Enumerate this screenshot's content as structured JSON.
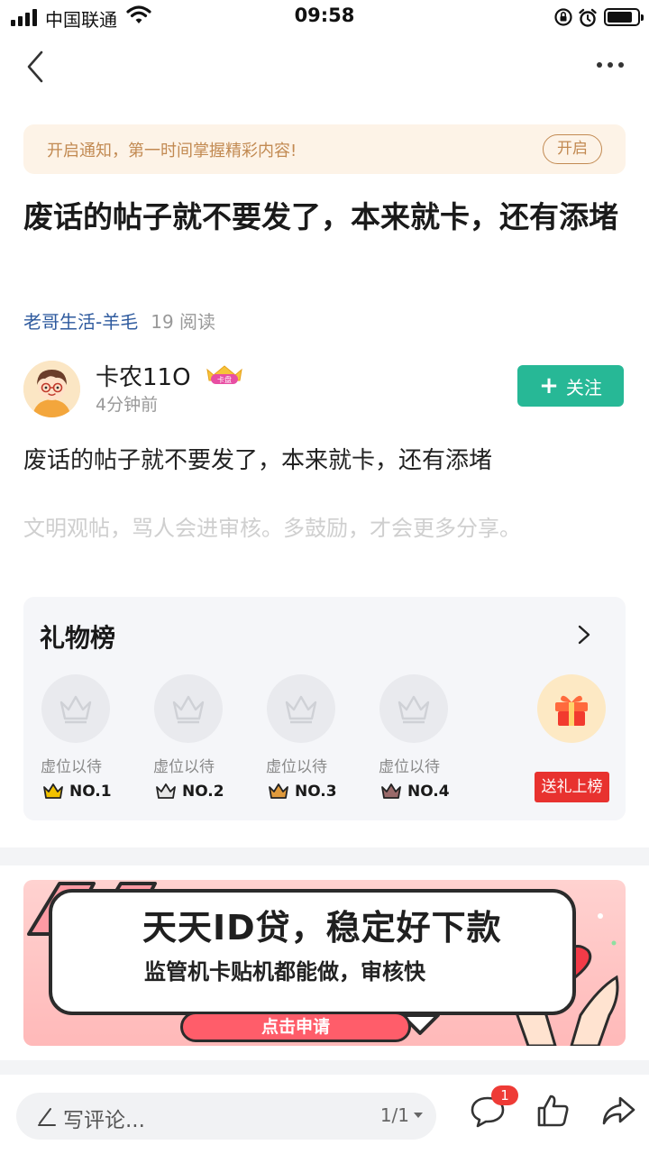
{
  "status_bar": {
    "carrier": "中国联通",
    "time": "09:58",
    "battery_level": 0.85
  },
  "notice": {
    "text": "开启通知，第一时间掌握精彩内容!",
    "button_label": "开启"
  },
  "post": {
    "title": "废话的帖子就不要发了，本来就卡，还有添堵",
    "group": "老哥生活-羊毛",
    "reads": "19 阅读",
    "body": "废话的帖子就不要发了，本来就卡，还有添堵",
    "hint": "文明观帖，骂人会进审核。多鼓励，才会更多分享。"
  },
  "author": {
    "name": "卡农11O",
    "badge_text": "卡盘",
    "time": "4分钟前",
    "follow_label": "关注"
  },
  "gift_board": {
    "title": "礼物榜",
    "slots": [
      {
        "label": "虚位以待",
        "rank": "NO.1",
        "crown_color": "#f2c200"
      },
      {
        "label": "虚位以待",
        "rank": "NO.2",
        "crown_color": "#c9c9c9"
      },
      {
        "label": "虚位以待",
        "rank": "NO.3",
        "crown_color": "#e09a3c"
      },
      {
        "label": "虚位以待",
        "rank": "NO.4",
        "crown_color": "#9a6a6a"
      }
    ],
    "send_label": "送礼上榜"
  },
  "ad": {
    "headline": "天天ID贷，稳定好下款",
    "subline": "监管机卡贴机都能做，审核快",
    "cta": "点击申请"
  },
  "bottom_bar": {
    "comment_placeholder": "写评论...",
    "page_indicator": "1/1",
    "comment_count": "1"
  },
  "colors": {
    "accent_green": "#27b896",
    "notice_text": "#c28a52",
    "link_blue": "#2e5a9e",
    "send_red": "#e8322f"
  }
}
